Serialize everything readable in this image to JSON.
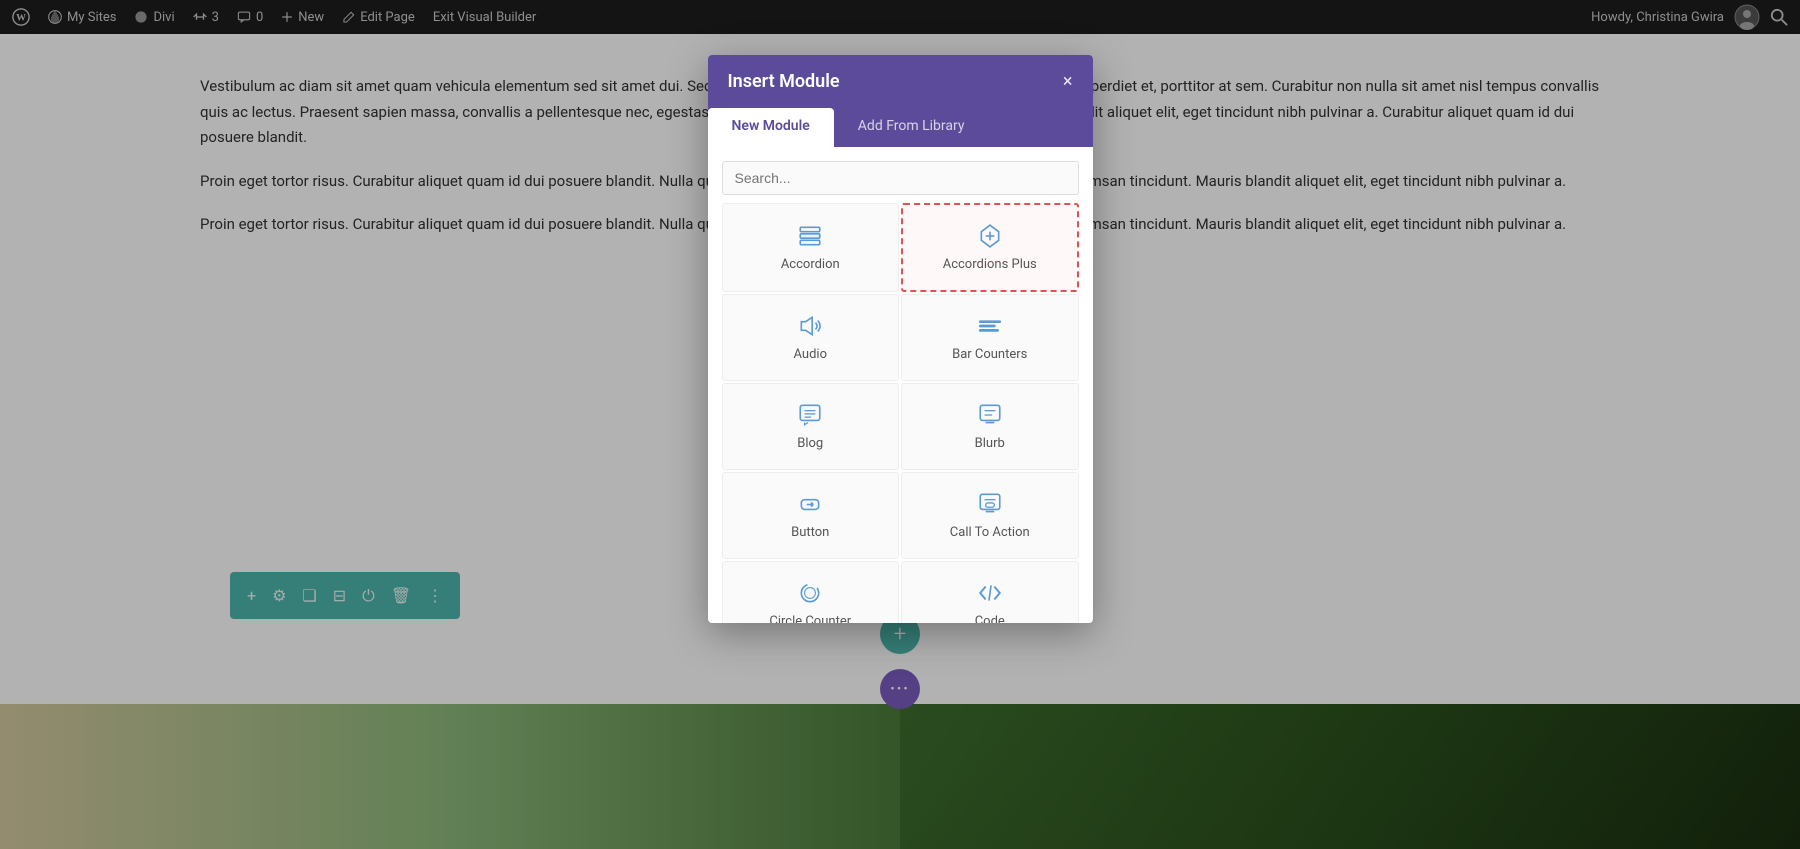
{
  "adminBar": {
    "wpLabel": "W",
    "mySites": "My Sites",
    "divi": "Divi",
    "revisions": "3",
    "comments": "0",
    "new": "New",
    "editPage": "Edit Page",
    "exitBuilder": "Exit Visual Builder",
    "userGreeting": "Howdy, Christina Gwira"
  },
  "page": {
    "paragraph1": "Vestibulum ac diam sit amet quam vehicula elementum sed sit amet dui. Sed porttitor lectus nibh. Curabitur arcu erat, accumsan id imperdiet et, porttitor at sem. Curabitur non nulla sit amet nisl tempus convallis quis ac lectus. Praesent sapien massa, convallis a pellentesque nec, egestas non nisi. Nulla porttitor accumsan tincidunt. Mauris blandit aliquet elit, eget tincidunt nibh pulvinar a. Curabitur aliquet quam id dui posuere blandit.",
    "paragraph2": "Proin eget tortor risus. Curabitur aliquet quam id dui posuere blandit. Nulla quis lorem ut libero malesuada feugiat. Nulla porttitor accumsan tincidunt. Mauris blandit aliquet elit, eget tincidunt nibh pulvinar a.",
    "paragraph3": "Proin eget tortor risus. Curabitur aliquet quam id dui posuere blandit. Nulla quis lorem ut libero malesuada feugiat. Nulla porttitor accumsan tincidunt. Mauris blandit aliquet elit, eget tincidunt nibh pulvinar a."
  },
  "modal": {
    "title": "Insert Module",
    "closeLabel": "×",
    "tabs": [
      {
        "id": "new-module",
        "label": "New Module",
        "active": true
      },
      {
        "id": "add-from-library",
        "label": "Add From Library",
        "active": false
      }
    ],
    "searchPlaceholder": "Search...",
    "modules": [
      {
        "id": "accordion",
        "label": "Accordion",
        "icon": "accordion",
        "highlighted": false
      },
      {
        "id": "accordions-plus",
        "label": "Accordions Plus",
        "icon": "accordions-plus",
        "highlighted": true
      },
      {
        "id": "audio",
        "label": "Audio",
        "icon": "audio",
        "highlighted": false
      },
      {
        "id": "bar-counters",
        "label": "Bar Counters",
        "icon": "bar-counters",
        "highlighted": false
      },
      {
        "id": "blog",
        "label": "Blog",
        "icon": "blog",
        "highlighted": false
      },
      {
        "id": "blurb",
        "label": "Blurb",
        "icon": "blurb",
        "highlighted": false
      },
      {
        "id": "button",
        "label": "Button",
        "icon": "button",
        "highlighted": false
      },
      {
        "id": "call-to-action",
        "label": "Call To Action",
        "icon": "call-to-action",
        "highlighted": false
      },
      {
        "id": "circle-counter",
        "label": "Circle Counter",
        "icon": "circle-counter",
        "highlighted": false
      },
      {
        "id": "code",
        "label": "Code",
        "icon": "code",
        "highlighted": false
      }
    ]
  },
  "toolbar": {
    "add": "+",
    "settings": "⚙",
    "copy": "❏",
    "columns": "⊞",
    "power": "⏻",
    "delete": "🗑",
    "more": "⋮"
  },
  "floatButtons": {
    "addDark": "+",
    "addTeal": "+",
    "menuPurple": "•••"
  },
  "colors": {
    "purple": "#5b4b9a",
    "teal": "#4db6ac",
    "blue": "#5b9bd5",
    "darkBar": "#1e1e1e"
  }
}
